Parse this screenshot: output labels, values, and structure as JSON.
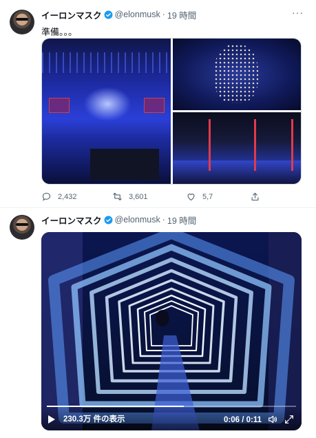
{
  "colors": {
    "verified": "#1d9bf0",
    "muted": "#536471",
    "text": "#0f1419",
    "divider": "#eff3f4"
  },
  "tweets": [
    {
      "author_name": "イーロンマスク",
      "handle": "@elonmusk",
      "time": "19 時間",
      "text": "準備。。。",
      "actions": {
        "replies": "2,432",
        "retweets": "3,601",
        "likes": "5,7"
      }
    },
    {
      "author_name": "イーロンマスク",
      "handle": "@elonmusk",
      "time": "19 時間",
      "video": {
        "views": "230.3万 件の表示",
        "time": "0:06 / 0:11",
        "progress": 0.55
      }
    }
  ],
  "separator": "·",
  "more_glyph": "···",
  "icons": [
    "verified-badge-icon",
    "more-icon",
    "reply-icon",
    "retweet-icon",
    "like-icon",
    "share-icon",
    "play-icon",
    "volume-icon",
    "fullscreen-icon"
  ]
}
